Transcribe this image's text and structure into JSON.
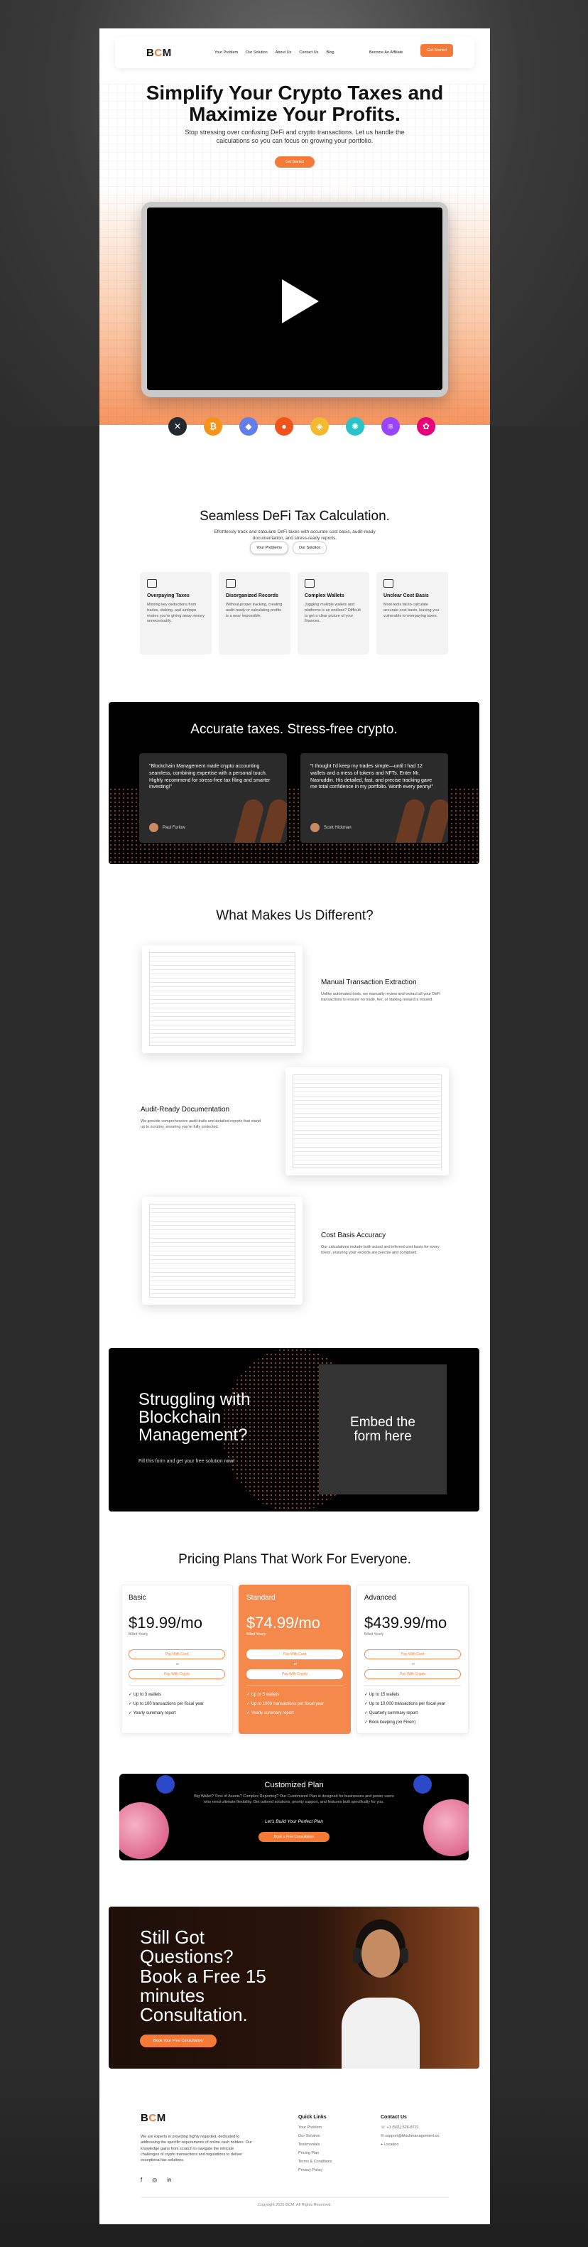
{
  "brand": {
    "logo_b": "B",
    "logo_c": "C",
    "logo_m": "M",
    "accent": "#f57a38"
  },
  "nav": {
    "links": [
      "Your Problem",
      "Our Solution",
      "About Us",
      "Contact Us",
      "Blog"
    ],
    "affiliate": "Become An Affiliate",
    "cta": "Get Started"
  },
  "hero": {
    "title_line1": "Simplify Your Crypto Taxes and",
    "title_line2": "Maximize Your Profits.",
    "subtitle": "Stop stressing over confusing DeFi and crypto transactions. Let us handle the calculations so you can focus on growing your portfolio.",
    "button": "Get Started",
    "watch_label": "Watch Video"
  },
  "coins": [
    {
      "icon": "xrp-icon",
      "glyph": "✕",
      "color": "#23292f"
    },
    {
      "icon": "bitcoin-icon",
      "glyph": "₿",
      "color": "#f7931a"
    },
    {
      "icon": "ethereum-icon",
      "glyph": "◆",
      "color": "#627eea"
    },
    {
      "icon": "shiba-icon",
      "glyph": "●",
      "color": "#f0541c"
    },
    {
      "icon": "bnb-icon",
      "glyph": "◈",
      "color": "#f3ba2f"
    },
    {
      "icon": "chainlink-icon",
      "glyph": "✺",
      "color": "#2ac3c8"
    },
    {
      "icon": "solana-icon",
      "glyph": "≡",
      "color": "#9945ff"
    },
    {
      "icon": "polkadot-icon",
      "glyph": "✿",
      "color": "#e6007a"
    }
  ],
  "defi": {
    "title": "Seamless DeFi Tax Calculation.",
    "subtitle": "Effortlessly track and calculate DeFi taxes with accurate cost basis, audit-ready documentation, and stress-ready reports.",
    "tab_problems": "Your Problems",
    "tab_solution": "Our Solution",
    "cards": [
      {
        "title": "Overpaying Taxes",
        "desc": "Missing key deductions from trades, staking, and airdrops makes you're giving away money unnecessarily."
      },
      {
        "title": "Disorganized Records",
        "desc": "Without proper tracking, creating audit-ready or calculating profits is a near impossible."
      },
      {
        "title": "Complex Wallets",
        "desc": "Juggling multiple wallets and platforms is an endless? Difficult to get a clear picture of your finances."
      },
      {
        "title": "Unclear Cost Basis",
        "desc": "Most tools fail to calculate accurate cost basis, leaving you vulnerable to overpaying taxes."
      }
    ]
  },
  "testimonials": {
    "title": "Accurate taxes. Stress-free crypto.",
    "items": [
      {
        "quote": "\"Blockchain Management made crypto accounting seamless, combining expertise with a personal touch. Highly recommend for stress-free tax filing and smarter investing!\"",
        "name": "Paul Furlow"
      },
      {
        "quote": "\"I thought I'd keep my trades simple—until I had 12 wallets and a mess of tokens and NFTs. Enter Mr. Nasruddin. His detailed, fast, and precise tracking gave me total confidence in my portfolio. Worth every penny!\"",
        "name": "Scott Hickman"
      }
    ]
  },
  "different": {
    "title": "What Makes Us Different?",
    "items": [
      {
        "title": "Manual Transaction Extraction",
        "desc": "Unlike automated tools, we manually review and extract all your DeFi transactions to ensure no trade, fee, or staking reward is missed."
      },
      {
        "title": "Audit-Ready Documentation",
        "desc": "We provide comprehensive audit trails and detailed reports that stand up to scrutiny, ensuring you're fully protected."
      },
      {
        "title": "Cost Basis Accuracy",
        "desc": "Our calculations include both actual and inferred cost basis for every token, ensuring your records are precise and compliant."
      }
    ]
  },
  "struggling": {
    "title_line1": "Struggling with",
    "title_line2": "Blockchain",
    "title_line3": "Management?",
    "subtitle": "Fill this form and get your free solution now!",
    "embed_line1": "Embed the",
    "embed_line2": "form here"
  },
  "pricing": {
    "title": "Pricing Plans That Work For Everyone.",
    "btn_card": "Pay With Card",
    "btn_crypto": "Pay With Crypto",
    "or": "or",
    "billed": "Billed Yearly",
    "plans": [
      {
        "name": "Basic",
        "price": "$19.99/mo",
        "features": [
          "Up to 3 wallets",
          "Up to 100 transactions per fiscal year",
          "Yearly summary report"
        ]
      },
      {
        "name": "Standard",
        "price": "$74.99/mo",
        "features": [
          "Up to 5 wallets",
          "Up to 1000 transactions per fiscal year",
          "Yearly summary report"
        ]
      },
      {
        "name": "Advanced",
        "price": "$439.99/mo",
        "features": [
          "Up to 15 wallets",
          "Up to 10,000 transactions per fiscal year",
          "Quarterly summary report",
          "Book keeping (on Fiverr)"
        ]
      }
    ],
    "custom": {
      "title": "Customized Plan",
      "subtitle": "Big Wallet? Tons of Assets? Complex Reporting? Our Customized Plan is designed for businesses and power users who need ultimate flexibility. Get tailored solutions, priority support, and features built specifically for you.",
      "tagline": "Let's Build Your Perfect Plan",
      "button": "Book a Free Consultation"
    }
  },
  "consult": {
    "line1": "Still Got",
    "line2": "Questions?",
    "line3": "Book a Free 15",
    "line4": "minutes",
    "line5": "Consultation.",
    "button": "Book Your Free Consultation"
  },
  "footer": {
    "desc": "We are experts in providing highly regarded, dedicated to addressing the specific requirements of online cash holders. Our knowledge gains from scratch to navigate the intricate challenges of crypto transactions and regulations to deliver exceptional tax solutions.",
    "quick_title": "Quick Links",
    "quick_links": [
      "Your Problem",
      "Our Solution",
      "Testimonials",
      "Pricing Plan",
      "Terms & Conditions",
      "Privacy Policy"
    ],
    "contact_title": "Contact Us",
    "contacts": [
      "+1 (561) 526-8721",
      "support@blockmanagement.co",
      "Location"
    ],
    "social": [
      "f",
      "◎",
      "in"
    ],
    "copyright": "Copyright 2025 BCM. All Rights Reserved."
  }
}
